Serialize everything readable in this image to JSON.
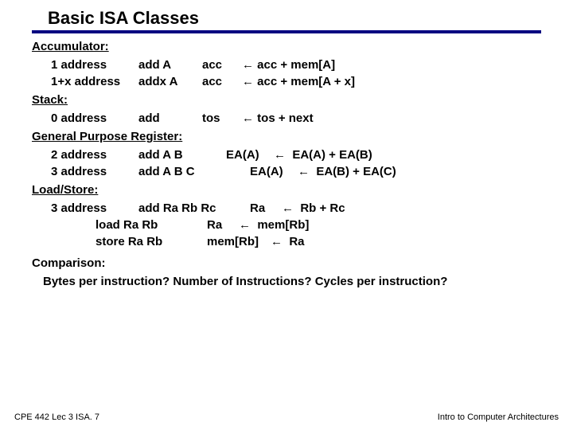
{
  "title": "Basic ISA Classes",
  "sections": {
    "accumulator": "Accumulator:",
    "stack": "Stack:",
    "gpr": "General Purpose Register:",
    "loadstore": "Load/Store:",
    "comparison": "Comparison:"
  },
  "rows": {
    "acc1": {
      "addr": "1 address",
      "instr": "add A",
      "lhs": "acc",
      "arrow": "←",
      "rhs": "acc + mem[A]"
    },
    "acc2": {
      "addr": "1+x address",
      "instr": "addx A",
      "lhs": "acc",
      "arrow": "←",
      "rhs": "acc + mem[A + x]"
    },
    "stk": {
      "addr": "0 address",
      "instr": "add",
      "lhs": "tos",
      "arrow": "←",
      "rhs": "tos + next"
    },
    "gpr2": {
      "addr": "2 address",
      "instr": "add A B",
      "lhs": "EA(A)",
      "arrow": "←",
      "rhs": "EA(A) + EA(B)"
    },
    "gpr3": {
      "addr": "3 address",
      "instr": "add A B C",
      "lhs": "EA(A)",
      "arrow": "←",
      "rhs": "EA(B) + EA(C)"
    },
    "ls1": {
      "addr": "3 address",
      "instr": "add Ra Rb Rc",
      "lhs": "Ra",
      "arrow": "←",
      "rhs": "Rb + Rc"
    },
    "ls2": {
      "instr": "load Ra Rb",
      "lhs": "Ra",
      "arrow": "←",
      "rhs": "mem[Rb]"
    },
    "ls3": {
      "instr": "store Ra Rb",
      "lhs": "mem[Rb]",
      "arrow": "←",
      "rhs": "Ra"
    }
  },
  "comparison_q": "Bytes per instruction?  Number of Instructions?  Cycles per instruction?",
  "footer": {
    "left": "CPE 442 Lec 3 ISA. 7",
    "right": "Intro to Computer Architectures"
  }
}
